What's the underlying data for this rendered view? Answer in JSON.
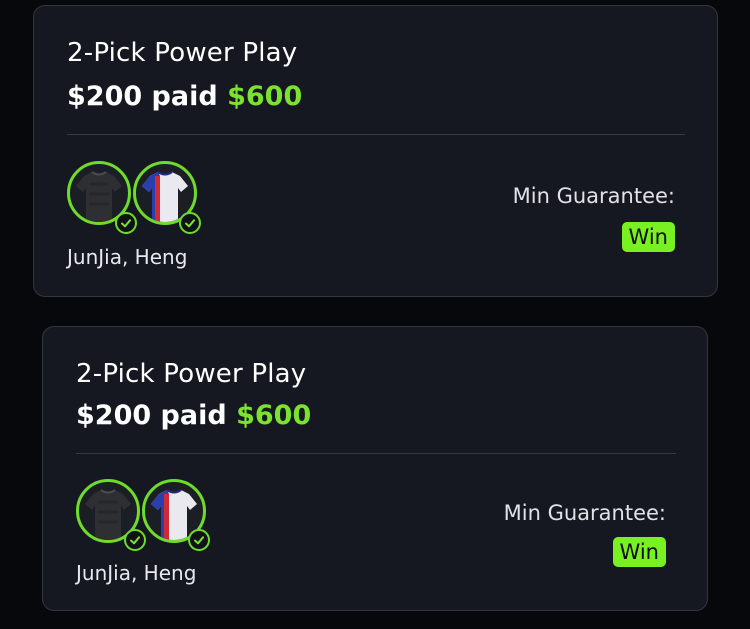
{
  "entries": [
    {
      "title": "2-Pick Power Play",
      "paid_text": "$200 paid",
      "payout_text": "$600",
      "players_text": "JunJia, Heng",
      "min_guarantee_label": "Min Guarantee:",
      "result_badge": "Win",
      "avatars": [
        {
          "icon": "dark-jersey-icon",
          "status_icon": "check-circle-icon"
        },
        {
          "icon": "blue-red-white-jersey-icon",
          "status_icon": "check-circle-icon"
        }
      ]
    },
    {
      "title": "2-Pick Power Play",
      "paid_text": "$200 paid",
      "payout_text": "$600",
      "players_text": "JunJia, Heng",
      "min_guarantee_label": "Min Guarantee:",
      "result_badge": "Win",
      "avatars": [
        {
          "icon": "dark-jersey-icon",
          "status_icon": "check-circle-icon"
        },
        {
          "icon": "blue-red-white-jersey-icon",
          "status_icon": "check-circle-icon"
        }
      ]
    }
  ],
  "colors": {
    "background": "#07080c",
    "card": "#161821",
    "accent_green": "#7be22e",
    "badge_green": "#78f021"
  }
}
